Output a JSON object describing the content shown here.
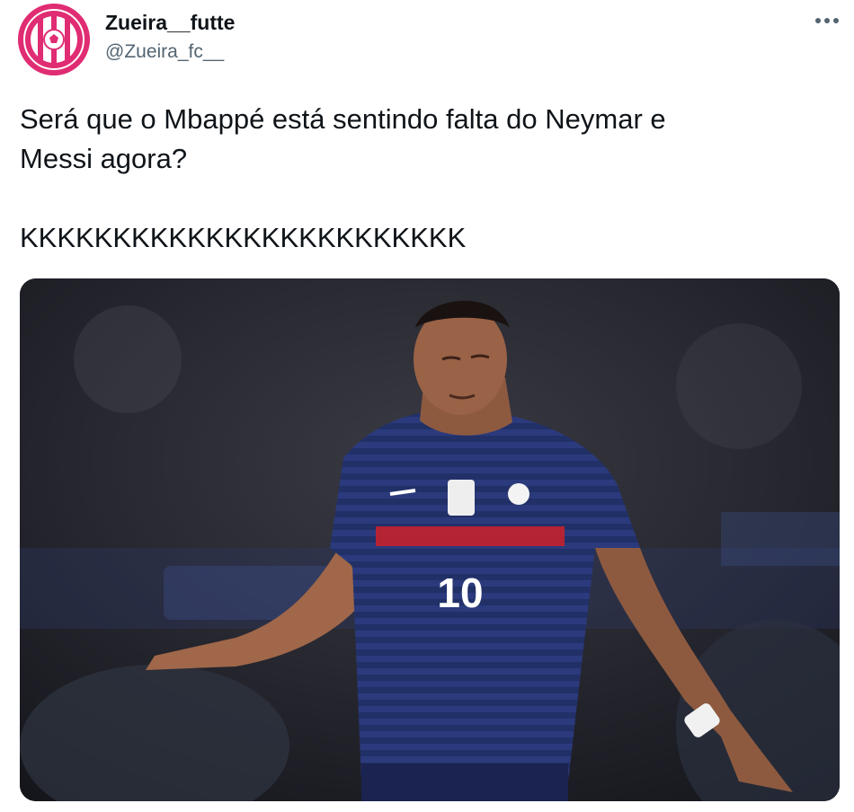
{
  "tweet": {
    "author_name": "Zueira__futte",
    "author_handle": "@Zueira_fc__",
    "text": "Será que o Mbappé está sentindo falta do Neymar e\nMessi agora?\n\nKKKKKKKKKKKKKKKKKKKKKKKK",
    "media": {
      "jersey_number": "10",
      "icon": "photo"
    }
  },
  "colors": {
    "avatar_bg": "#e02c73",
    "jersey": "#25346e",
    "jersey_stripe": "#c4222e",
    "text": "#0f1419",
    "secondary_text": "#536471"
  }
}
